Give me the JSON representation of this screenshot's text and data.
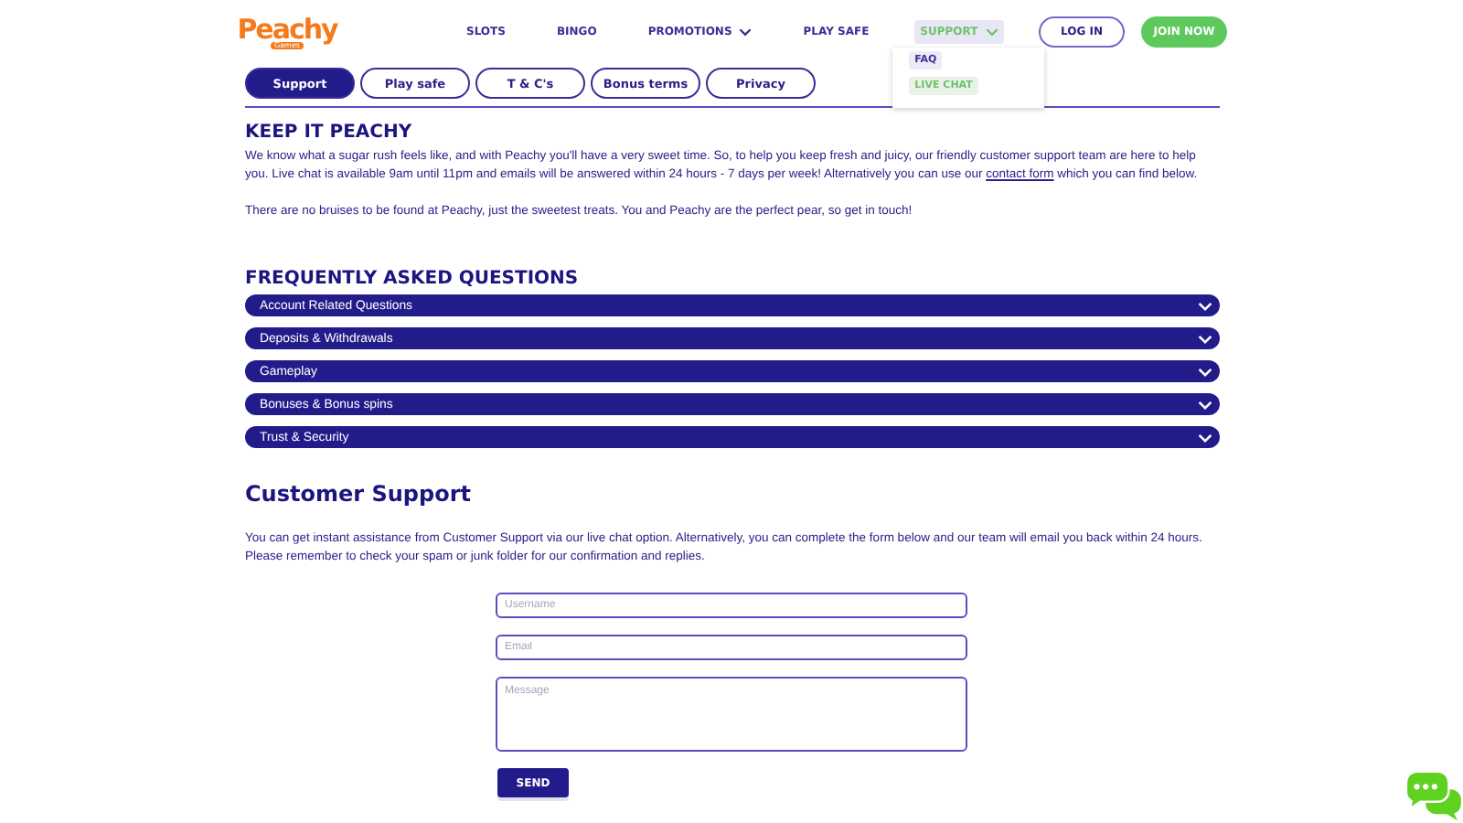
{
  "header": {
    "logo": {
      "name": "Peachy",
      "sub": "Games"
    },
    "nav": [
      {
        "label": "SLOTS",
        "dropdown": false,
        "selected": false
      },
      {
        "label": "BINGO",
        "dropdown": false,
        "selected": false
      },
      {
        "label": "PROMOTIONS",
        "dropdown": true,
        "selected": false
      },
      {
        "label": "PLAY SAFE",
        "dropdown": false,
        "selected": false
      },
      {
        "label": "SUPPORT",
        "dropdown": true,
        "selected": true
      }
    ],
    "menu": [
      {
        "label": "FAQ",
        "selected": false
      },
      {
        "label": "LIVE CHAT",
        "selected": true
      }
    ],
    "buttons": [
      {
        "label": "LOG IN",
        "kind": "outline"
      },
      {
        "label": "JOIN NOW",
        "kind": "filled"
      }
    ]
  },
  "tabs": [
    {
      "label": "Support",
      "selected": true
    },
    {
      "label": "Play safe",
      "selected": false
    },
    {
      "label": "T & C's",
      "selected": false
    },
    {
      "label": "Bonus terms",
      "selected": false
    },
    {
      "label": "Privacy",
      "selected": false
    }
  ],
  "intro": {
    "title": "KEEP IT PEACHY",
    "text_before": "We know what a sugar rush feels like, and with Peachy you'll have a very sweet time. So, to help you keep fresh and juicy, our friendly customer support team are here to help you. Live chat is available 9am until 11pm and emails will be answered within 24 hours - 7 days per week! Alternatively you can use our",
    "link": "contact form",
    "text_after": "which you can find below.",
    "note": "There are no bruises to be found at Peachy, just the sweetest treats. You and Peachy are the perfect pear, so get in touch!"
  },
  "faq": {
    "title": "FREQUENTLY ASKED QUESTIONS",
    "items": [
      {
        "label": "Account Related Questions",
        "expanded": false
      },
      {
        "label": "Deposits & Withdrawals",
        "expanded": false
      },
      {
        "label": "Gameplay",
        "expanded": false
      },
      {
        "label": "Bonuses & Bonus spins",
        "expanded": false
      },
      {
        "label": "Trust & Security",
        "expanded": false
      }
    ]
  },
  "support": {
    "title": "Customer Support",
    "text": "You can get instant assistance from Customer Support via our live chat option. Alternatively, you can complete the form below and our team will email you back within 24 hours. Please remember to check your spam or junk folder for our confirmation and replies.",
    "fields": [
      {
        "placeholder": "Username",
        "kind": "line"
      },
      {
        "placeholder": "Email",
        "kind": "line"
      },
      {
        "placeholder": "Message",
        "kind": "area"
      }
    ],
    "button": "SEND"
  }
}
